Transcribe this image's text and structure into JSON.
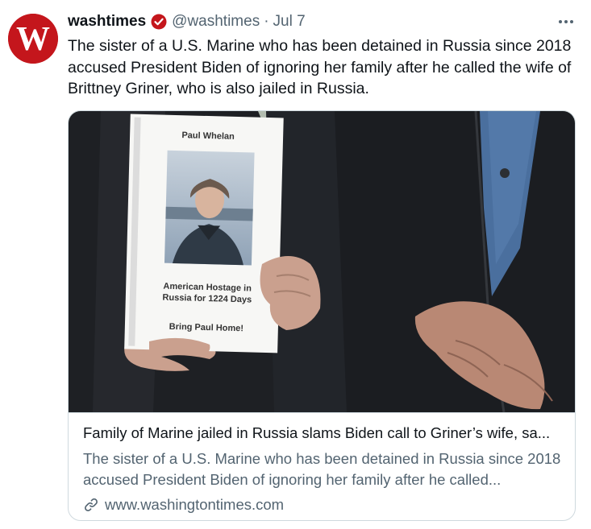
{
  "tweet": {
    "display_name": "washtimes",
    "handle": "@washtimes",
    "separator": "·",
    "date": "Jul 7",
    "text": "The sister of a U.S. Marine who has been detained in Russia since 2018 accused President Biden of ignoring her family after he called the wife of Brittney Griner, who is also jailed in Russia.",
    "avatar_icon": "washington-times-logo-icon",
    "verified_icon": "verified-badge-icon",
    "more_icon": "more-options-icon"
  },
  "card": {
    "title": "Family of Marine jailed in Russia slams Biden call to Griner’s wife, sa...",
    "description": "The sister of a U.S. Marine who has been detained in Russia since 2018 accused President Biden of ignoring her family after he called...",
    "domain": "www.washingtontimes.com",
    "link_icon": "link-icon",
    "sign": {
      "name": "Paul Whelan",
      "line1": "American Hostage in",
      "line2": "Russia for 1224 Days",
      "line3": "Bring Paul Home!"
    }
  },
  "colors": {
    "brand_red": "#c4161c",
    "text_primary": "#0f1419",
    "text_secondary": "#536471",
    "border": "#cfd9de"
  }
}
